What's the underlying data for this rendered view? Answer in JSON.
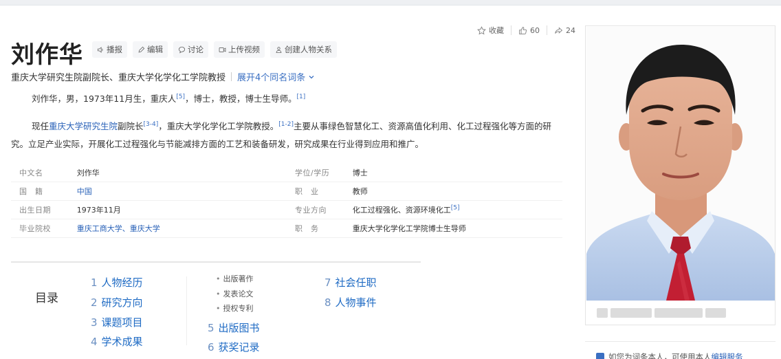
{
  "actions": {
    "favorite_label": "收藏",
    "like_count": "60",
    "share_count": "24"
  },
  "title": "刘作华",
  "tools": [
    {
      "icon": "speaker-icon",
      "label": "播报"
    },
    {
      "icon": "edit-icon",
      "label": "编辑"
    },
    {
      "icon": "comment-icon",
      "label": "讨论"
    },
    {
      "icon": "video-icon",
      "label": "上传视频"
    },
    {
      "icon": "relation-icon",
      "label": "创建人物关系"
    }
  ],
  "subtitle": {
    "text": "重庆大学研究生院副院长、重庆大学化学化工学院教授",
    "expand": "展开4个同名词条"
  },
  "p1": {
    "text": "刘作华，男，1973年11月生，重庆人",
    "ref1": "[5]",
    "text2": "，博士，教授，博士生导师。",
    "ref2": "[1]"
  },
  "p2": {
    "pre": "现任",
    "link": "重庆大学研究生院",
    "mid": "副院长",
    "ref1": "[3-4]",
    "mid2": "，重庆大学化学化工学院教授。",
    "ref2": "[1-2]",
    "rest": "主要从事绿色智慧化工、资源高值化利用、化工过程强化等方面的研究。立足产业实际，开展化工过程强化与节能减排方面的工艺和装备研发，研究成果在行业得到应用和推广。"
  },
  "info": {
    "rows": [
      {
        "k1": "中文名",
        "v1": "刘作华",
        "k2": "学位/学历",
        "v2": "博士"
      },
      {
        "k1": "国　籍",
        "v1": "中国",
        "k2": "职　业",
        "v2": "教师"
      },
      {
        "k1": "出生日期",
        "v1": "1973年11月",
        "k2": "专业方向",
        "v2": "化工过程强化、资源环境化工",
        "ref": "[5]"
      },
      {
        "k1": "毕业院校",
        "v1": "重庆工商大学、重庆大学",
        "k2": "职　务",
        "v2": "重庆大学化学化工学院博士生导师"
      }
    ]
  },
  "toc": {
    "title": "目录",
    "items": [
      {
        "n": "1",
        "label": "人物经历"
      },
      {
        "n": "2",
        "label": "研究方向"
      },
      {
        "n": "3",
        "label": "课题项目"
      },
      {
        "n": "4",
        "label": "学术成果"
      },
      {
        "n": "5",
        "label": "出版图书"
      },
      {
        "n": "6",
        "label": "获奖记录"
      },
      {
        "n": "7",
        "label": "社会任职"
      },
      {
        "n": "8",
        "label": "人物事件"
      }
    ],
    "subs": [
      "出版著作",
      "发表论文",
      "授权专利"
    ]
  },
  "notice": {
    "text": "如您为词条本人，可使用本人",
    "link": "编辑服务"
  }
}
